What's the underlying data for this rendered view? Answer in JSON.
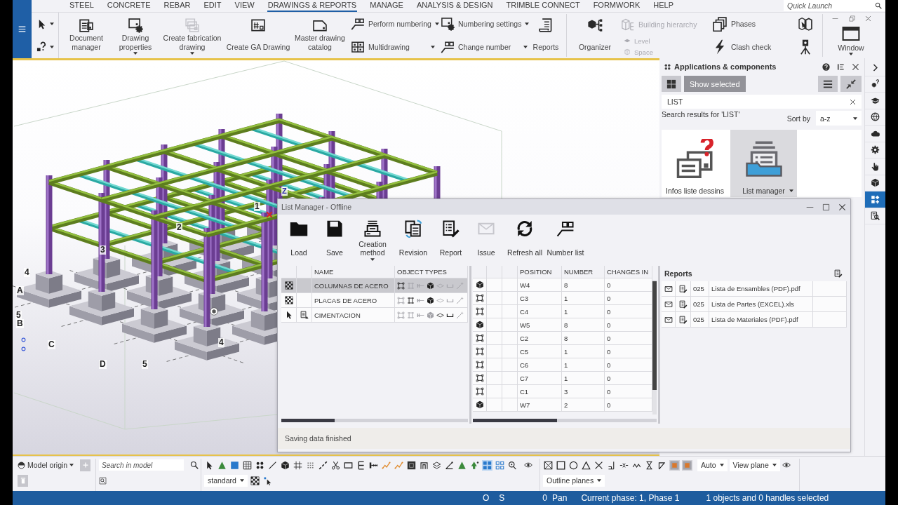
{
  "menu_tabs": [
    {
      "label": "STEEL",
      "selected": false
    },
    {
      "label": "CONCRETE",
      "selected": false
    },
    {
      "label": "REBAR",
      "selected": false
    },
    {
      "label": "EDIT",
      "selected": false
    },
    {
      "label": "VIEW",
      "selected": false
    },
    {
      "label": "DRAWINGS & REPORTS",
      "selected": true
    },
    {
      "label": "MANAGE",
      "selected": false
    },
    {
      "label": "ANALYSIS & DESIGN",
      "selected": false
    },
    {
      "label": "TRIMBLE CONNECT",
      "selected": false
    },
    {
      "label": "FORMWORK",
      "selected": false
    },
    {
      "label": "HELP",
      "selected": false
    }
  ],
  "quick_launch": {
    "placeholder": "Quick Launch"
  },
  "ribbon": {
    "drawing_buttons": [
      {
        "label": "Document manager",
        "kind": "document",
        "dropdown": false
      },
      {
        "label": "Drawing properties",
        "kind": "properties",
        "dropdown": true
      },
      {
        "label": "Create fabrication drawing",
        "kind": "fabrication",
        "dropdown": true
      },
      {
        "label": "Create GA Drawing",
        "kind": "ga",
        "dropdown": false
      },
      {
        "label": "Master drawing catalog",
        "kind": "master",
        "dropdown": false
      }
    ],
    "numbering_buttons": [
      {
        "label": "Perform numbering",
        "kind": "numbering",
        "dropdown": true
      },
      {
        "label": "Multidrawing",
        "kind": "multi",
        "dropdown": true
      },
      {
        "label": "Numbering settings",
        "kind": "settings",
        "dropdown": true
      },
      {
        "label": "Change number",
        "kind": "numbering",
        "dropdown": true
      }
    ],
    "reports_button": {
      "label": "Reports"
    },
    "organizer_button": {
      "label": "Organizer"
    },
    "hierarchy_buttons": [
      {
        "label": "Building hierarchy",
        "kind": "hierarchy",
        "disabled": true
      },
      {
        "label": "Level",
        "kind": "level",
        "disabled": true
      },
      {
        "label": "Space",
        "kind": "space",
        "disabled": true
      }
    ],
    "model_buttons": [
      {
        "label": "Phases",
        "kind": "phases"
      },
      {
        "label": "Clash check",
        "kind": "clash"
      }
    ],
    "window_button": {
      "label": "Window",
      "dropdown": true
    }
  },
  "model_view": {
    "grid_labels": [
      "4",
      "A",
      "5",
      "B",
      "C",
      "D",
      "5",
      "4",
      "3",
      "2",
      "1",
      "Z"
    ]
  },
  "apps_panel": {
    "title": "Applications & components",
    "show_selected": {
      "label": "Show selected",
      "disabled": true
    },
    "search": {
      "value": "LIST"
    },
    "results_caption": "Search results for 'LIST'",
    "sort": {
      "label": "Sort by",
      "value": "a-z"
    },
    "apps": [
      {
        "label": "Infos liste dessins",
        "kind": "info",
        "selected": false,
        "dropdown": false
      },
      {
        "label": "List manager",
        "kind": "list",
        "selected": true,
        "dropdown": true
      }
    ]
  },
  "side_bar": [
    {
      "kind": "expand",
      "selected": false
    },
    {
      "kind": "help",
      "selected": false
    },
    {
      "kind": "learning",
      "selected": false
    },
    {
      "kind": "web",
      "selected": false
    },
    {
      "kind": "cloud",
      "selected": false
    },
    {
      "kind": "settings",
      "selected": false
    },
    {
      "kind": "touch",
      "selected": false
    },
    {
      "kind": "model",
      "selected": false
    },
    {
      "kind": "applications",
      "selected": true
    },
    {
      "kind": "search",
      "selected": false
    }
  ],
  "list_manager": {
    "title": "List Manager - Offline",
    "tools": [
      {
        "label": "Load",
        "kind": "load",
        "dropdown": false,
        "disabled": false
      },
      {
        "label": "Save",
        "kind": "save",
        "dropdown": false,
        "disabled": false
      },
      {
        "label": "Creation method",
        "kind": "creation",
        "dropdown": true,
        "disabled": false
      },
      {
        "label": "Revision",
        "kind": "revision",
        "dropdown": false,
        "disabled": false
      },
      {
        "label": "Report",
        "kind": "report",
        "dropdown": false,
        "disabled": false
      },
      {
        "label": "Issue",
        "kind": "issue",
        "dropdown": false,
        "disabled": true
      },
      {
        "label": "Refresh all",
        "kind": "refresh",
        "dropdown": false,
        "disabled": false
      },
      {
        "label": "Number list",
        "kind": "number",
        "dropdown": false,
        "disabled": false
      }
    ],
    "lists_table": {
      "columns": [
        "NAME",
        "OBJECT TYPES"
      ],
      "rows": [
        {
          "kind": "pattern",
          "report": false,
          "name": "COLUMNAS DE ACERO",
          "object_types": [
            true,
            false,
            false,
            true,
            false,
            false,
            false
          ],
          "selected": true
        },
        {
          "kind": "pattern",
          "report": false,
          "name": "PLACAS DE ACERO",
          "object_types": [
            false,
            true,
            false,
            true,
            false,
            false,
            false
          ],
          "selected": false
        },
        {
          "kind": "selection",
          "report": true,
          "name": "CIMENTACION",
          "object_types": [
            false,
            false,
            false,
            false,
            true,
            true,
            false
          ],
          "selected": false
        }
      ]
    },
    "positions_table": {
      "columns": [
        "POSITION",
        "NUMBER",
        "CHANGES IN"
      ],
      "rows": [
        {
          "kind": "cube",
          "position": "W4",
          "number": "8",
          "changes": "0"
        },
        {
          "kind": "frame",
          "position": "C3",
          "number": "1",
          "changes": "0"
        },
        {
          "kind": "frame",
          "position": "C4",
          "number": "1",
          "changes": "0"
        },
        {
          "kind": "cube",
          "position": "W5",
          "number": "8",
          "changes": "0"
        },
        {
          "kind": "frame",
          "position": "C2",
          "number": "8",
          "changes": "0"
        },
        {
          "kind": "frame",
          "position": "C5",
          "number": "1",
          "changes": "0"
        },
        {
          "kind": "frame",
          "position": "C6",
          "number": "1",
          "changes": "0"
        },
        {
          "kind": "frame",
          "position": "C7",
          "number": "1",
          "changes": "0"
        },
        {
          "kind": "frame",
          "position": "C1",
          "number": "3",
          "changes": "0"
        },
        {
          "kind": "cube",
          "position": "W7",
          "number": "2",
          "changes": "0"
        }
      ]
    },
    "reports": {
      "title": "Reports",
      "rows": [
        {
          "code": "025",
          "file": "Lista de Ensambles (PDF).pdf"
        },
        {
          "code": "025",
          "file": "Lista de Partes (EXCEL).xls"
        },
        {
          "code": "025",
          "file": "Lista de Materiales (PDF).pdf"
        }
      ]
    },
    "status": "Saving data finished"
  },
  "bottom_toolbar": {
    "model_origin": {
      "label": "Model origin"
    },
    "search": {
      "placeholder": "Search in model"
    },
    "snap_tools": [
      {
        "kind": "pointer",
        "selected": false
      },
      {
        "kind": "figure",
        "selected": false
      },
      {
        "kind": "fill",
        "selected": false
      },
      {
        "kind": "gridbox",
        "selected": false
      },
      {
        "kind": "dots",
        "selected": false
      },
      {
        "kind": "line",
        "selected": false
      },
      {
        "kind": "cube",
        "selected": false
      },
      {
        "kind": "grid",
        "selected": false
      },
      {
        "kind": "dotgrid",
        "selected": false
      },
      {
        "kind": "dashes",
        "selected": false
      },
      {
        "kind": "scissors",
        "selected": false
      },
      {
        "kind": "rectangle",
        "selected": false
      },
      {
        "kind": "bracket",
        "selected": false
      },
      {
        "kind": "tbar",
        "selected": false
      },
      {
        "kind": "zigzag",
        "selected": false
      },
      {
        "kind": "zigzag",
        "selected": false
      },
      {
        "kind": "darkbox",
        "selected": false
      },
      {
        "kind": "arch",
        "selected": false
      },
      {
        "kind": "layers",
        "selected": false
      },
      {
        "kind": "angle",
        "selected": false
      },
      {
        "kind": "figure",
        "selected": false
      },
      {
        "kind": "arrow",
        "selected": false
      },
      {
        "kind": "squares",
        "selected": true
      },
      {
        "kind": "outlinegrid",
        "selected": false
      },
      {
        "kind": "pin",
        "selected": false
      }
    ],
    "snap_style": {
      "value": "standard"
    },
    "snap_modes": [
      {
        "kind": "boxcross",
        "selected": false
      },
      {
        "kind": "square",
        "selected": false
      },
      {
        "kind": "circle",
        "selected": false
      },
      {
        "kind": "triangle",
        "selected": false
      },
      {
        "kind": "cross",
        "selected": false
      },
      {
        "kind": "perpendicular",
        "selected": false
      },
      {
        "kind": "xline",
        "selected": false
      },
      {
        "kind": "wave",
        "selected": false
      },
      {
        "kind": "hourglass",
        "selected": false
      },
      {
        "kind": "corner",
        "selected": false
      },
      {
        "kind": "inset",
        "selected": true
      },
      {
        "kind": "inset",
        "selected": true
      }
    ],
    "depth": {
      "value": "Auto"
    },
    "plane": {
      "value": "View plane"
    },
    "outline": {
      "value": "Outline planes"
    }
  },
  "status_bar": [
    "O",
    "S",
    "0",
    "Pan",
    "Current phase: 1, Phase 1",
    "1 objects and 0 handles selected"
  ]
}
